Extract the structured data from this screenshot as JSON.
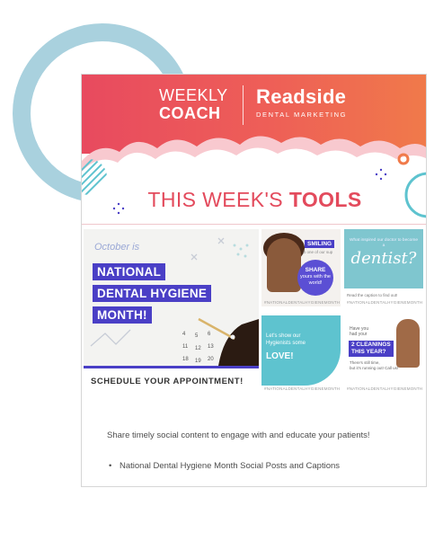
{
  "header": {
    "weekly_line1": "WEEKLY",
    "weekly_line2": "COACH",
    "brand_name": "Readside",
    "brand_tagline": "DENTAL MARKETING"
  },
  "tools_title": {
    "prefix": "THIS WEEK'S ",
    "bold": "TOOLS"
  },
  "promo": {
    "kicker": "October is",
    "headline": [
      "NATIONAL",
      "DENTAL HYGIENE",
      "MONTH!"
    ],
    "cta": "SCHEDULE YOUR APPOINTMENT!"
  },
  "tiles": {
    "smiling": {
      "pill": "SMILING",
      "small": "is one of our sup",
      "bubble_bold": "SHARE",
      "bubble_rest": "yours with the world!",
      "tag": "#NATIONALDENTALHYGIENEMONTH"
    },
    "dentist": {
      "question": "What inspired our doctor to become a",
      "script": "dentist?",
      "footer": "Read the caption to find out!",
      "tag": "#NATIONALDENTALHYGIENEMONTH"
    },
    "love": {
      "line1": "Let's show our",
      "line2": "Hygienists some",
      "big": "LOVE!",
      "tag": "#NATIONALDENTALHYGIENEMONTH"
    },
    "cleanings": {
      "q1a": "Have you",
      "q1b": "had your",
      "pill_a": "2 CLEANINGS",
      "pill_b": "THIS YEAR?",
      "q2a": "There's still time,",
      "q2b": "but it's running out! Call us!",
      "tag": "#NATIONALDENTALHYGIENEMONTH"
    }
  },
  "description": "Share timely social content to engage with and educate your patients!",
  "list_items": [
    "National Dental Hygiene Month Social Posts and Captions"
  ],
  "colors": {
    "header_red": "#e84a5f",
    "header_orange": "#f07a4a",
    "purple": "#4a3fc6",
    "teal": "#5ec3cf",
    "ring": "#a9d1de"
  }
}
